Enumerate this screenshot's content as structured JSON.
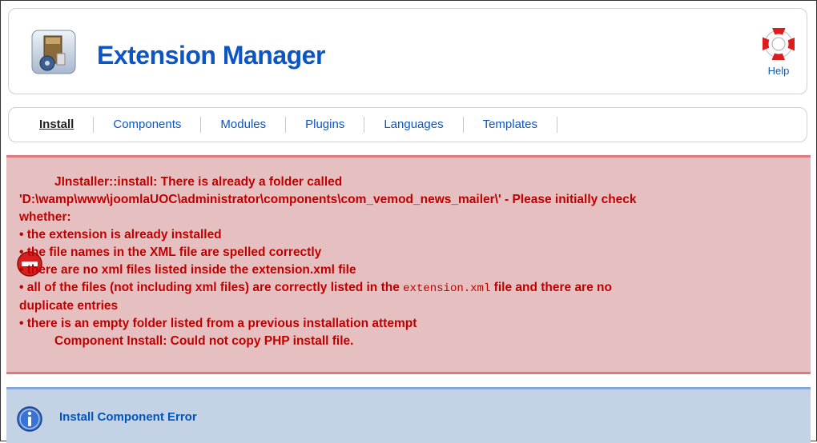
{
  "header": {
    "title": "Extension Manager",
    "icon": "extension-package-icon",
    "help_label": "Help",
    "help_icon": "lifebuoy-icon"
  },
  "tabs": [
    {
      "label": "Install",
      "active": true
    },
    {
      "label": "Components",
      "active": false
    },
    {
      "label": "Modules",
      "active": false
    },
    {
      "label": "Plugins",
      "active": false
    },
    {
      "label": "Languages",
      "active": false
    },
    {
      "label": "Templates",
      "active": false
    }
  ],
  "error": {
    "icon": "no-entry-icon",
    "line1": "JInstaller::install: There is already a folder called",
    "line2": "'D:\\wamp\\www\\joomlaUOC\\administrator\\components\\com_vemod_news_mailer\\' - Please initially check",
    "line3": "whether:",
    "bullet1": "• the extension is already installed",
    "bullet2": "• the file names in the XML file are spelled correctly",
    "bullet3": "• there are no xml files listed inside the extension.xml file",
    "bullet4_pre": "• all of the files (not including xml files) are correctly listed in the ",
    "bullet4_code": "extension.xml",
    "bullet4_post": " file and there are no",
    "bullet4_cont": "duplicate entries",
    "bullet5": "• there is an empty folder listed from a previous installation attempt",
    "footer": "Component Install: Could not copy PHP install file.",
    "color": "#c00000",
    "background": "#e6c0c0"
  },
  "notice": {
    "icon": "info-icon",
    "text": "Install Component Error",
    "background": "#c3d2e5"
  }
}
